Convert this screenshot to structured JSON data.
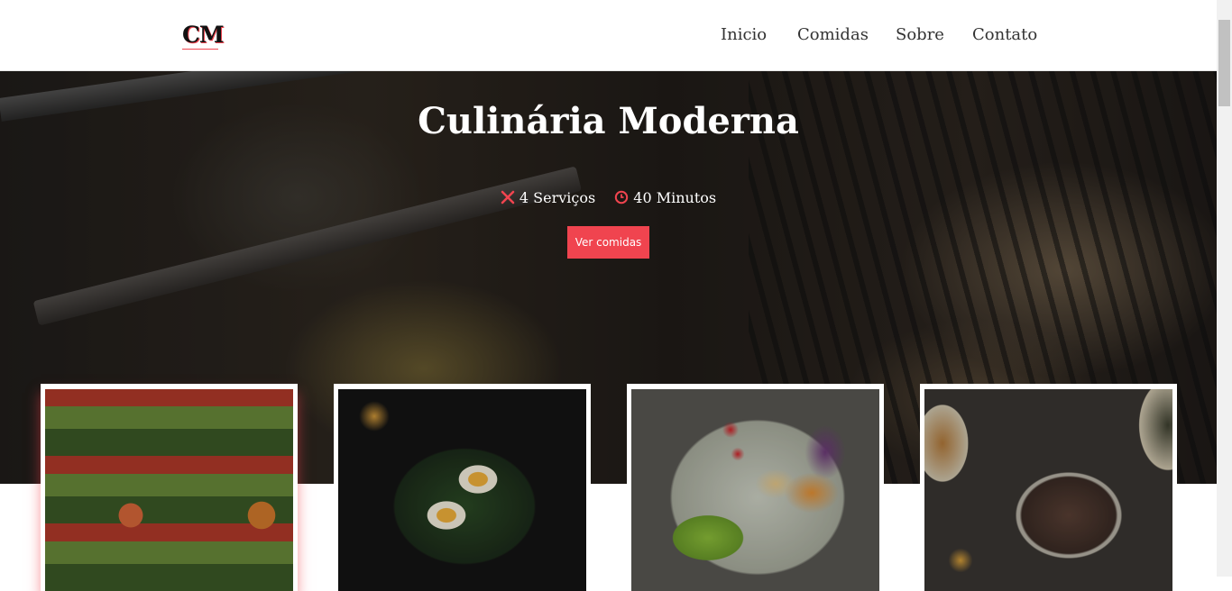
{
  "header": {
    "logo": "CM",
    "nav": [
      "Inicio",
      "Comidas",
      "Sobre",
      "Contato"
    ]
  },
  "hero": {
    "title": "Culinária Moderna",
    "servings": "4 Serviços",
    "time": "40 Minutos",
    "cta": "Ver comidas"
  },
  "colors": {
    "accent": "#f0444f"
  },
  "icons": {
    "servings": "utensils-icon",
    "time": "clock-icon"
  },
  "cards": [
    {
      "name": "salad-bar"
    },
    {
      "name": "egg-salad"
    },
    {
      "name": "veggie-bowl"
    },
    {
      "name": "steak-plate"
    }
  ]
}
